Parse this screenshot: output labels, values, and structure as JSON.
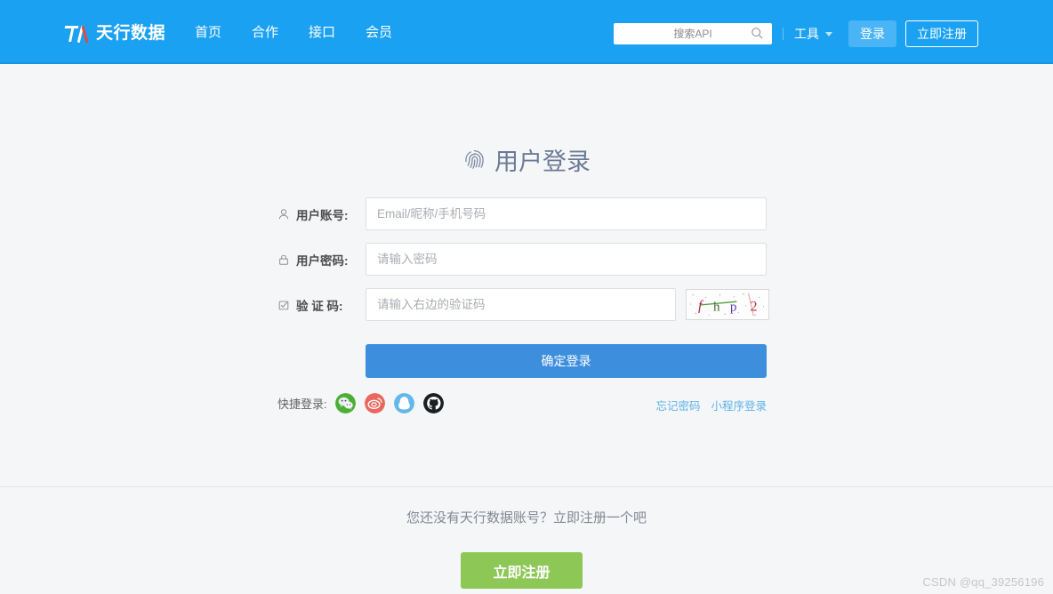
{
  "header": {
    "logo_text": "天行数据",
    "logo_icon": "tx-logo-icon",
    "nav": [
      {
        "label": "首页"
      },
      {
        "label": "合作"
      },
      {
        "label": "接口"
      },
      {
        "label": "会员"
      }
    ],
    "search": {
      "placeholder": "搜索API",
      "value": "",
      "icon": "search-icon"
    },
    "tools_label": "工具",
    "tools_caret": "chevron-down-icon",
    "login_button": "登录",
    "register_button": "立即注册",
    "background_color": "#1ba1f2"
  },
  "main": {
    "title": "用户登录",
    "title_icon": "fingerprint-icon",
    "fields": [
      {
        "icon": "user-icon",
        "label": "用户账号:",
        "placeholder": "Email/昵称/手机号码",
        "value": ""
      },
      {
        "icon": "lock-icon",
        "label": "用户密码:",
        "placeholder": "请输入密码",
        "value": ""
      },
      {
        "icon": "shield-check-icon",
        "label": "验 证 码:",
        "placeholder": "请输入右边的验证码",
        "value": ""
      }
    ],
    "captcha": {
      "characters": [
        "f",
        "h",
        "p",
        "2"
      ],
      "colors": [
        "#b02a3a",
        "#4a6b2f",
        "#5b3fa8",
        "#cc3333"
      ],
      "alt": "captcha-image"
    },
    "submit_button": "确定登录",
    "submit_color": "#3d8fde",
    "quick_login_label": "快捷登录:",
    "social_logins": [
      {
        "name": "wechat-icon",
        "color": "#4caf35"
      },
      {
        "name": "weibo-icon",
        "color": "#e8685f"
      },
      {
        "name": "qq-icon",
        "color": "#63b8ea"
      },
      {
        "name": "github-icon",
        "color": "#1b1f23"
      }
    ],
    "links": [
      {
        "label": "忘记密码"
      },
      {
        "label": "小程序登录"
      }
    ],
    "link_color": "#5cb3ea"
  },
  "footer": {
    "prompt": "您还没有天行数据账号？立即注册一个吧",
    "register_button": "立即注册",
    "register_color": "#8dc756",
    "watermark": "CSDN @qq_39256196"
  }
}
